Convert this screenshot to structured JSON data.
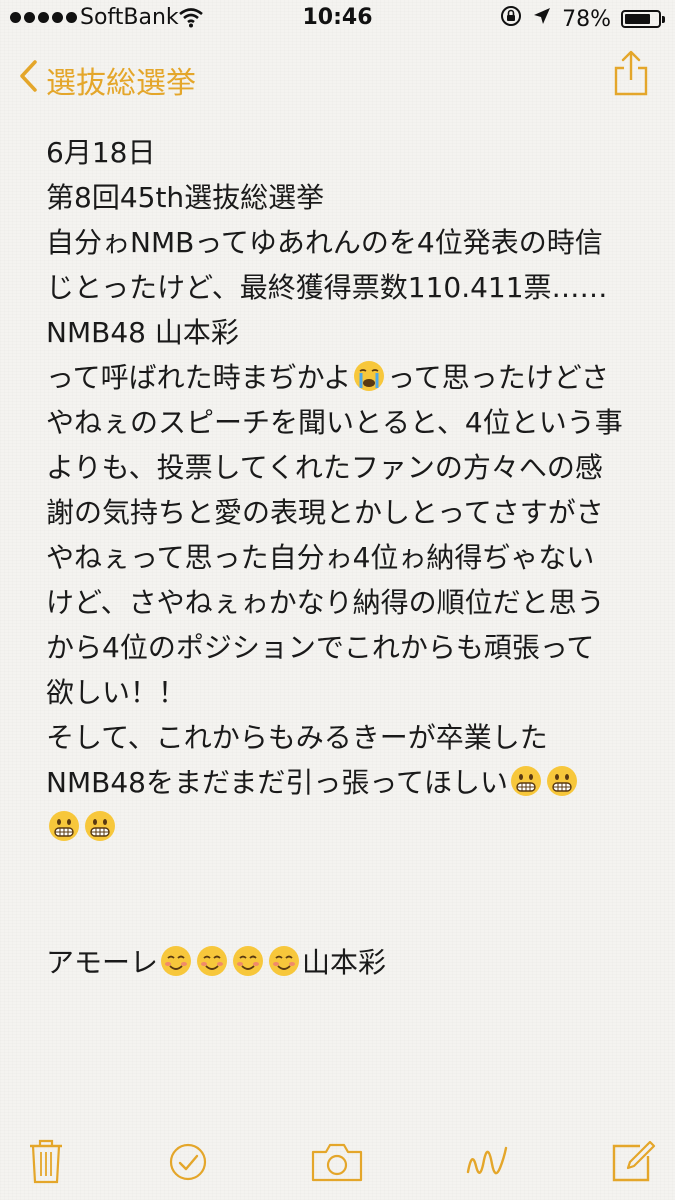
{
  "status_bar": {
    "carrier": "SoftBank",
    "time": "10:46",
    "battery_percent": "78%",
    "battery_level": 0.78
  },
  "nav": {
    "back_label": "選抜総選挙",
    "accent_color": "#e4a62a"
  },
  "note": {
    "lines": [
      "6月18日",
      "第8回45th選抜総選挙",
      "自分ゎNMBってゆあれんのを4位発表の時信",
      "じとったけど、最終獲得票数110.411票……",
      "NMB48  山本彩",
      "って呼ばれた時まぢかよ",
      "って思ったけどさ",
      "やねぇのスピーチを聞いとると、4位という事",
      "よりも、投票してくれたファンの方々への感",
      "謝の気持ちと愛の表現とかしとってさすがさ",
      "やねぇって思った自分ゎ4位ゎ納得ぢゃない",
      "けど、さやねぇゎかなり納得の順位だと思う",
      "から4位のポジションでこれからも頑張って",
      "欲しい！！",
      "そして、これからもみるきーが卒業した",
      "NMB48をまだまだ引っ張ってほしい",
      "アモーレ",
      "山本彩"
    ],
    "emoji": {
      "crying": "crying-face-emoji",
      "grinning": "grimacing-face-emoji",
      "smiling": "smiling-face-emoji"
    }
  },
  "toolbar": {
    "icons": [
      "trash-icon",
      "checkmark-icon",
      "camera-icon",
      "sketch-icon",
      "compose-icon"
    ]
  }
}
